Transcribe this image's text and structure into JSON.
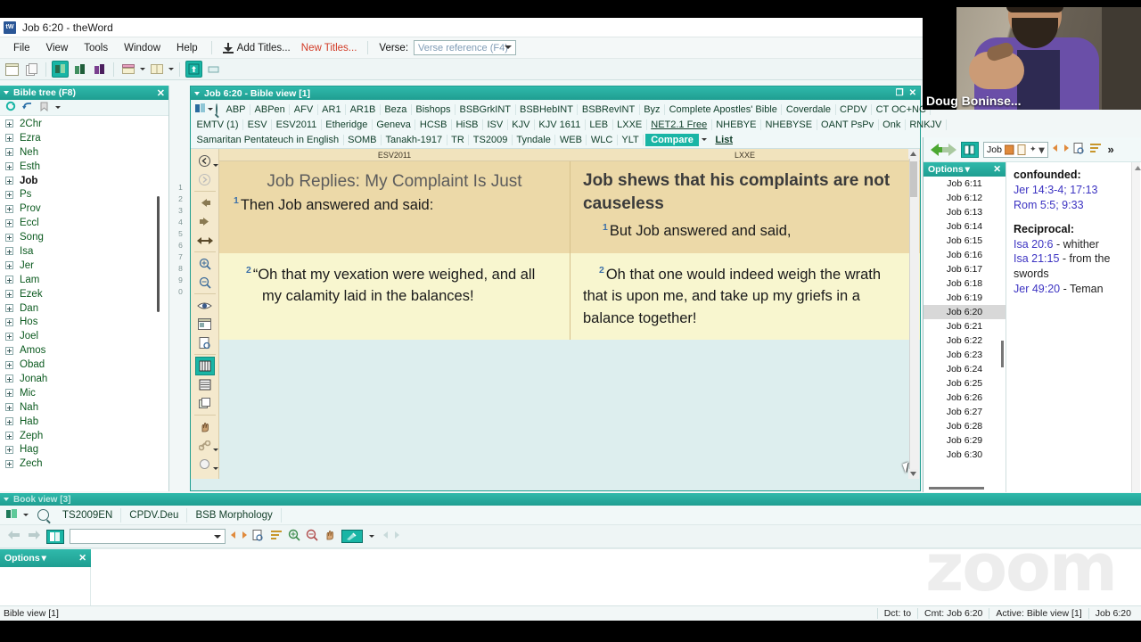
{
  "window": {
    "title": "Job 6:20 - theWord",
    "app_icon": "tW"
  },
  "menubar": {
    "items": [
      "File",
      "View",
      "Tools",
      "Window",
      "Help"
    ],
    "add_titles": "Add Titles...",
    "new_titles": "New Titles...",
    "verse_label": "Verse:",
    "verse_placeholder": "Verse reference (F4)"
  },
  "bible_tree": {
    "title": "Bible tree (F8)",
    "close": "✕",
    "books": [
      {
        "label": "2Chr",
        "bold": false
      },
      {
        "label": "Ezra",
        "bold": false
      },
      {
        "label": "Neh",
        "bold": false
      },
      {
        "label": "Esth",
        "bold": false
      },
      {
        "label": "Job",
        "bold": true
      },
      {
        "label": "Ps",
        "bold": false
      },
      {
        "label": "Prov",
        "bold": false
      },
      {
        "label": "Eccl",
        "bold": false
      },
      {
        "label": "Song",
        "bold": false
      },
      {
        "label": "Isa",
        "bold": false
      },
      {
        "label": "Jer",
        "bold": false
      },
      {
        "label": "Lam",
        "bold": false
      },
      {
        "label": "Ezek",
        "bold": false
      },
      {
        "label": "Dan",
        "bold": false
      },
      {
        "label": "Hos",
        "bold": false
      },
      {
        "label": "Joel",
        "bold": false
      },
      {
        "label": "Amos",
        "bold": false
      },
      {
        "label": "Obad",
        "bold": false
      },
      {
        "label": "Jonah",
        "bold": false
      },
      {
        "label": "Mic",
        "bold": false
      },
      {
        "label": "Nah",
        "bold": false
      },
      {
        "label": "Hab",
        "bold": false
      },
      {
        "label": "Zeph",
        "bold": false
      },
      {
        "label": "Hag",
        "bold": false
      },
      {
        "label": "Zech",
        "bold": false
      }
    ]
  },
  "bible_view": {
    "title": "Job 6:20 - Bible view [1]",
    "restore": "❐",
    "close": "✕",
    "version_tabs_row1": [
      "ABP",
      "ABPen",
      "AFV",
      "AR1",
      "AR1B",
      "Beza",
      "Bishops",
      "BSBGrkINT",
      "BSBHebINT",
      "BSBRevINT",
      "Byz",
      "Complete Apostles' Bible",
      "Coverdale",
      "CPDV",
      "CT OC+NC"
    ],
    "version_tabs_row2": [
      "EMTV (1)",
      "ESV",
      "ESV2011",
      "Etheridge",
      "Geneva",
      "HCSB",
      "HiSB",
      "ISV",
      "KJV",
      "KJV 1611",
      "LEB",
      "LXXE",
      "NET2.1 Free",
      "NHEBYE",
      "NHEBYSE",
      "OANT PsPv",
      "Onk",
      "RNKJV"
    ],
    "version_tabs_row3": [
      "Samaritan Pentateuch in English",
      "SOMB",
      "Tanakh-1917",
      "TR",
      "TS2009",
      "Tyndale",
      "WEB",
      "WLC",
      "YLT"
    ],
    "active_version": "NET2.1 Free",
    "compare_button": "Compare",
    "list_button": "List",
    "columns": [
      "ESV2011",
      "LXXE"
    ],
    "verse_strip_numbers": [
      "1",
      "2",
      "3",
      "4",
      "5",
      "6",
      "7",
      "8",
      "9",
      "0"
    ],
    "passages": [
      {
        "verse": "1",
        "esv_heading": "Job Replies: My Complaint Is Just",
        "esv_text": "Then Job answered and said:",
        "lxx_heading": "Job shews that his complaints are not causeless",
        "lxx_text": "But Job answered and said,"
      },
      {
        "verse": "2",
        "esv_heading": "",
        "esv_text": "“Oh that my vexation were weighed, and all my calamity laid in the balances!",
        "lxx_heading": "",
        "lxx_text": "Oh that one would indeed weigh the wrath that is upon me, and take up my griefs in a balance together!"
      }
    ]
  },
  "right_panel": {
    "nav_field_value": "Job",
    "overflow": "»",
    "verse_list": {
      "options_label": "Options",
      "close": "✕",
      "items": [
        "Job 6:11",
        "Job 6:12",
        "Job 6:13",
        "Job 6:14",
        "Job 6:15",
        "Job 6:16",
        "Job 6:17",
        "Job 6:18",
        "Job 6:19",
        "Job 6:20",
        "Job 6:21",
        "Job 6:22",
        "Job 6:23",
        "Job 6:24",
        "Job 6:25",
        "Job 6:26",
        "Job 6:27",
        "Job 6:28",
        "Job 6:29",
        "Job 6:30"
      ],
      "selected": "Job 6:20"
    },
    "cross_references": [
      {
        "title": "confounded:",
        "lines": [
          {
            "ref": "Jer 14:3-4; 17:13",
            "note": ""
          },
          {
            "ref": "Rom 5:5; 9:33",
            "note": ""
          }
        ]
      },
      {
        "title": "Reciprocal:",
        "lines": [
          {
            "ref": "Isa 20:6",
            "note": " - whither"
          },
          {
            "ref": "Isa 21:15",
            "note": " - from the swords"
          },
          {
            "ref": "Jer 49:20",
            "note": " - Teman"
          }
        ]
      }
    ]
  },
  "book_view": {
    "title": "Book view [3]",
    "tabs": [
      "TS2009EN",
      "CPDV.Deu",
      "BSB Morphology"
    ],
    "options_label": "Options",
    "close": "✕",
    "watermark": "zoom"
  },
  "status_bar": {
    "left": "Bible view [1]",
    "cells": [
      "Dct: to",
      "Cmt: Job 6:20",
      "Active: Bible view [1]",
      "Job 6:20"
    ]
  },
  "webcam": {
    "participant_name": "Doug Boninse..."
  },
  "colors": {
    "accent_teal": "#19b5a5",
    "panel_header": "#1f9e91",
    "verse_bg_odd": "#ecd9a8",
    "verse_bg_even": "#f8f6cf",
    "ref_link": "#3c33c2",
    "new_titles_red": "#d23b26",
    "verse_number": "#3b6fa8"
  }
}
